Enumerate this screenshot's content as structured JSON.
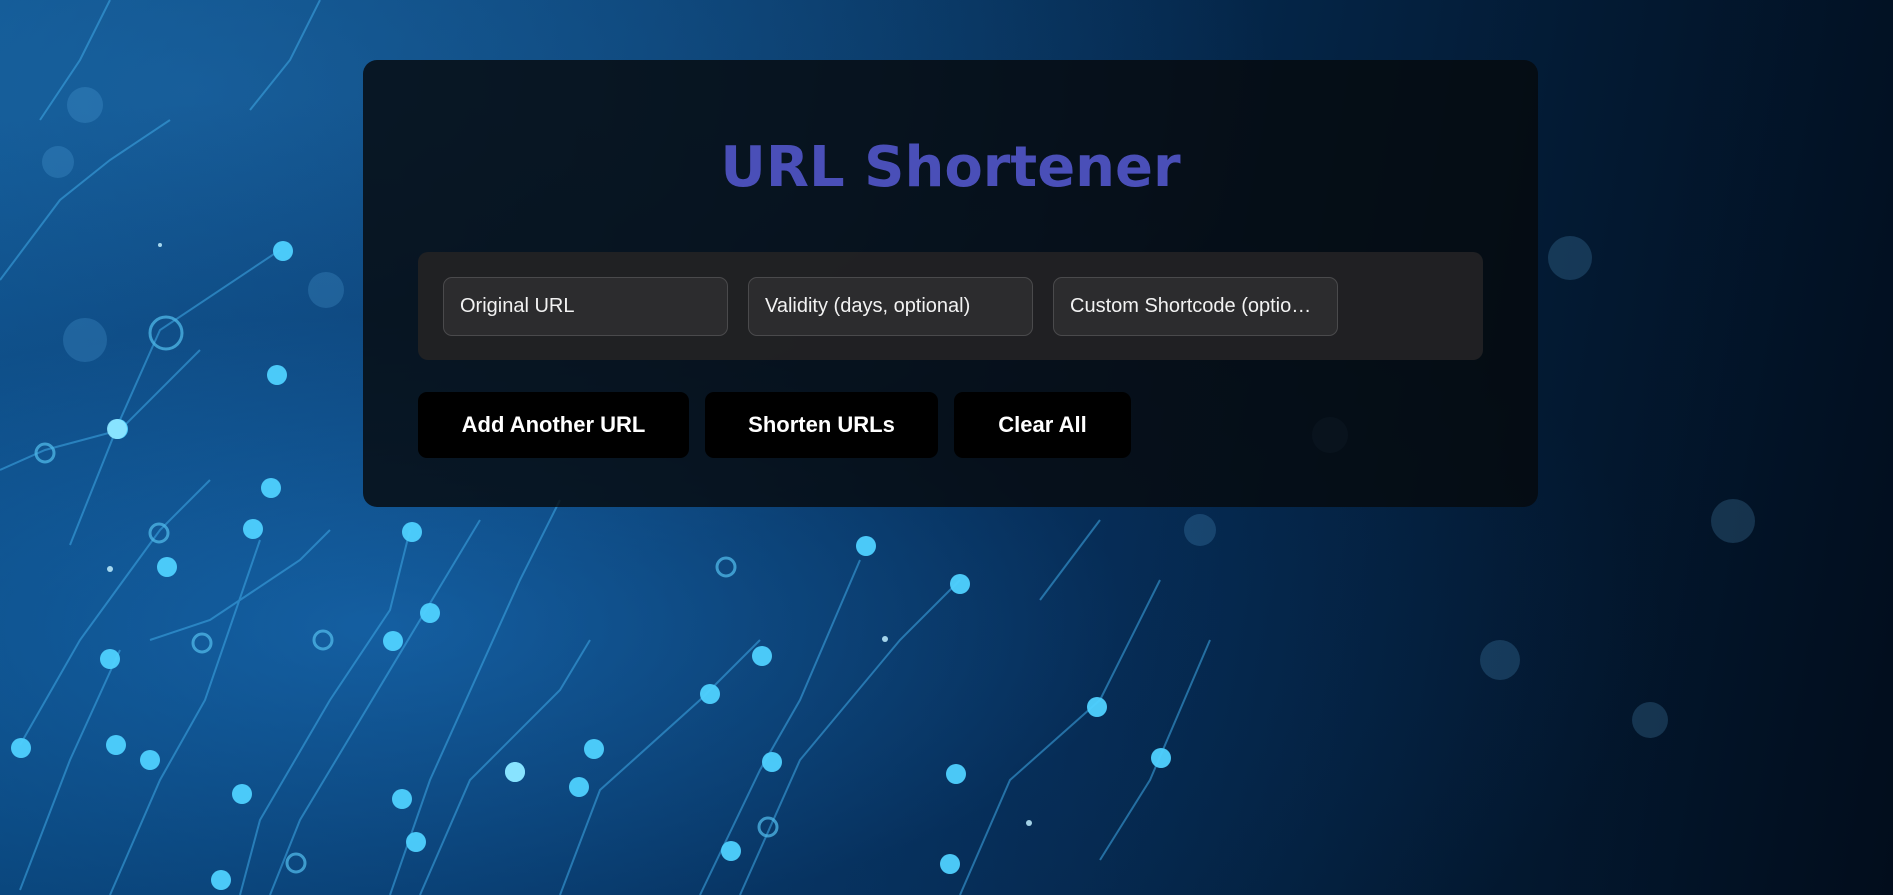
{
  "app": {
    "title": "URL Shortener"
  },
  "form": {
    "fields": [
      {
        "placeholder": "Original URL",
        "value": ""
      },
      {
        "placeholder": "Validity (days, optional)",
        "value": ""
      },
      {
        "placeholder": "Custom Shortcode (optio…",
        "value": ""
      }
    ]
  },
  "actions": {
    "add_label": "Add Another URL",
    "shorten_label": "Shorten URLs",
    "clear_label": "Clear All"
  },
  "colors": {
    "title": "#4a4fb8",
    "button_bg": "#000000",
    "background_accent": "#2aa8e8"
  }
}
